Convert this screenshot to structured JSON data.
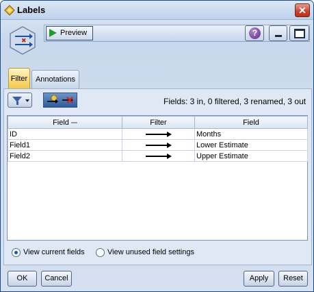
{
  "window": {
    "title": "Labels"
  },
  "toolbar": {
    "preview_label": "Preview",
    "help_symbol": "?"
  },
  "tabs": [
    {
      "label": "Filter",
      "active": true
    },
    {
      "label": "Annotations",
      "active": false
    }
  ],
  "fields_summary": "Fields: 3 in, 0 filtered, 3 renamed, 3 out",
  "table": {
    "columns": [
      "Field",
      "Filter",
      "Field"
    ],
    "rows": [
      {
        "field": "ID",
        "output": "Months"
      },
      {
        "field": "Field1",
        "output": "Lower Estimate"
      },
      {
        "field": "Field2",
        "output": "Upper Estimate"
      }
    ]
  },
  "options": {
    "view_current": "View current fields",
    "view_unused": "View unused field settings",
    "selected": "view_current"
  },
  "buttons": {
    "ok": "OK",
    "cancel": "Cancel",
    "apply": "Apply",
    "reset": "Reset"
  },
  "colors": {
    "active_tab": "#f4c84a",
    "accent": "#2d5a9a",
    "close": "#c84a33"
  }
}
